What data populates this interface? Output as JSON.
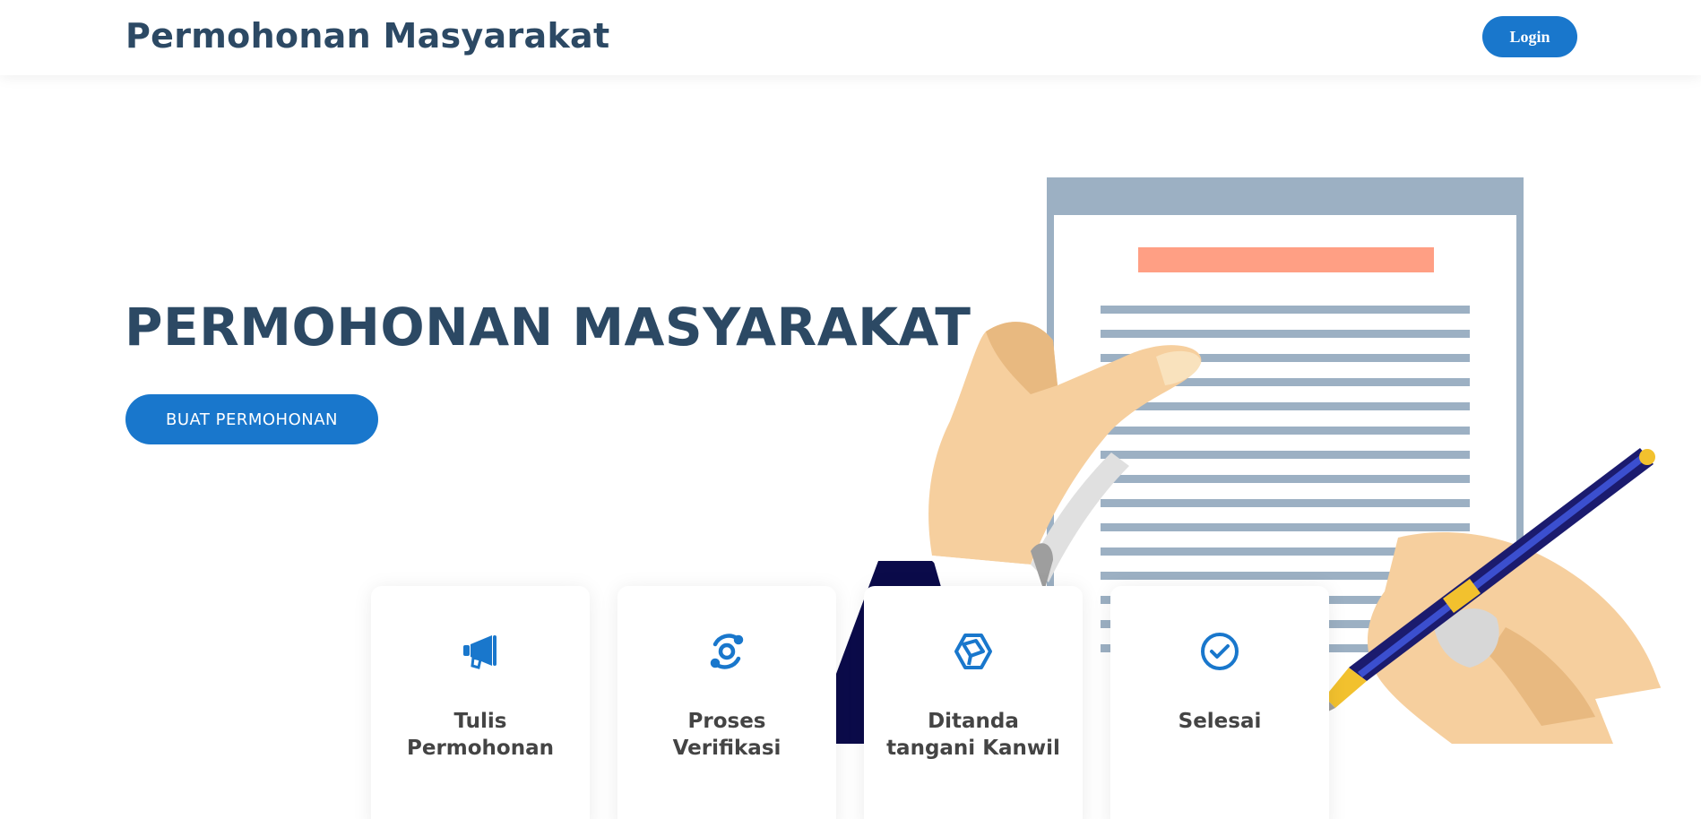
{
  "header": {
    "brand": "Permohonan Masyarakat",
    "login_label": "Login"
  },
  "hero": {
    "title": "PERMOHONAN MASYARAKAT",
    "cta_label": "BUAT PERMOHONAN"
  },
  "steps": [
    {
      "label": "Tulis Permohonan",
      "icon": "megaphone-icon"
    },
    {
      "label": "Proses Verifikasi",
      "icon": "target-sync-icon"
    },
    {
      "label": "Ditanda tangani Kanwil",
      "icon": "hexagon-box-icon"
    },
    {
      "label": "Selesai",
      "icon": "check-circle-icon"
    }
  ],
  "colors": {
    "primary": "#1977cc",
    "heading": "#2c4964",
    "card_text": "#444444",
    "document_frame": "#9cb0c3",
    "document_header_bar": "#ff9f84",
    "skin": "#f6cf9e",
    "sleeve": "#0b0b4a"
  }
}
